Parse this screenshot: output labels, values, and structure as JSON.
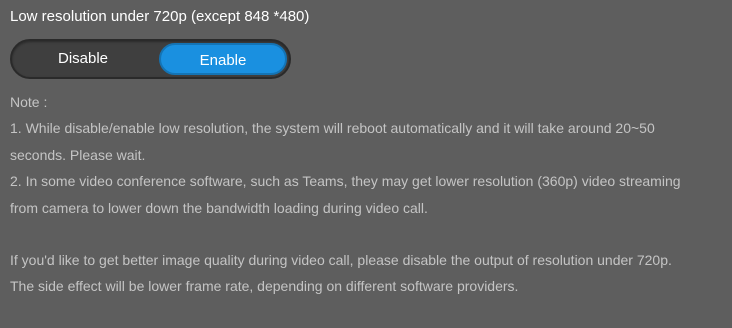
{
  "setting": {
    "title": "Low resolution under 720p (except 848 *480)",
    "options": {
      "disable_label": "Disable",
      "enable_label": "Enable",
      "selected": "Enable"
    }
  },
  "note": {
    "heading": "Note :",
    "lines": [
      "1. While disable/enable low resolution, the system will reboot automatically and it will take around 20~50",
      "seconds. Please wait.",
      "2. In some video conference software, such as Teams, they may get lower resolution (360p) video streaming",
      "from camera to lower down the bandwidth loading during video call.",
      "If you'd like to get better image quality during video call, please disable the output of resolution under 720p.",
      "The side effect will be lower frame rate, depending on different software providers."
    ]
  },
  "colors": {
    "background": "#5e5e5e",
    "accent": "#1a90e0",
    "note_text": "#c4c4c4"
  }
}
